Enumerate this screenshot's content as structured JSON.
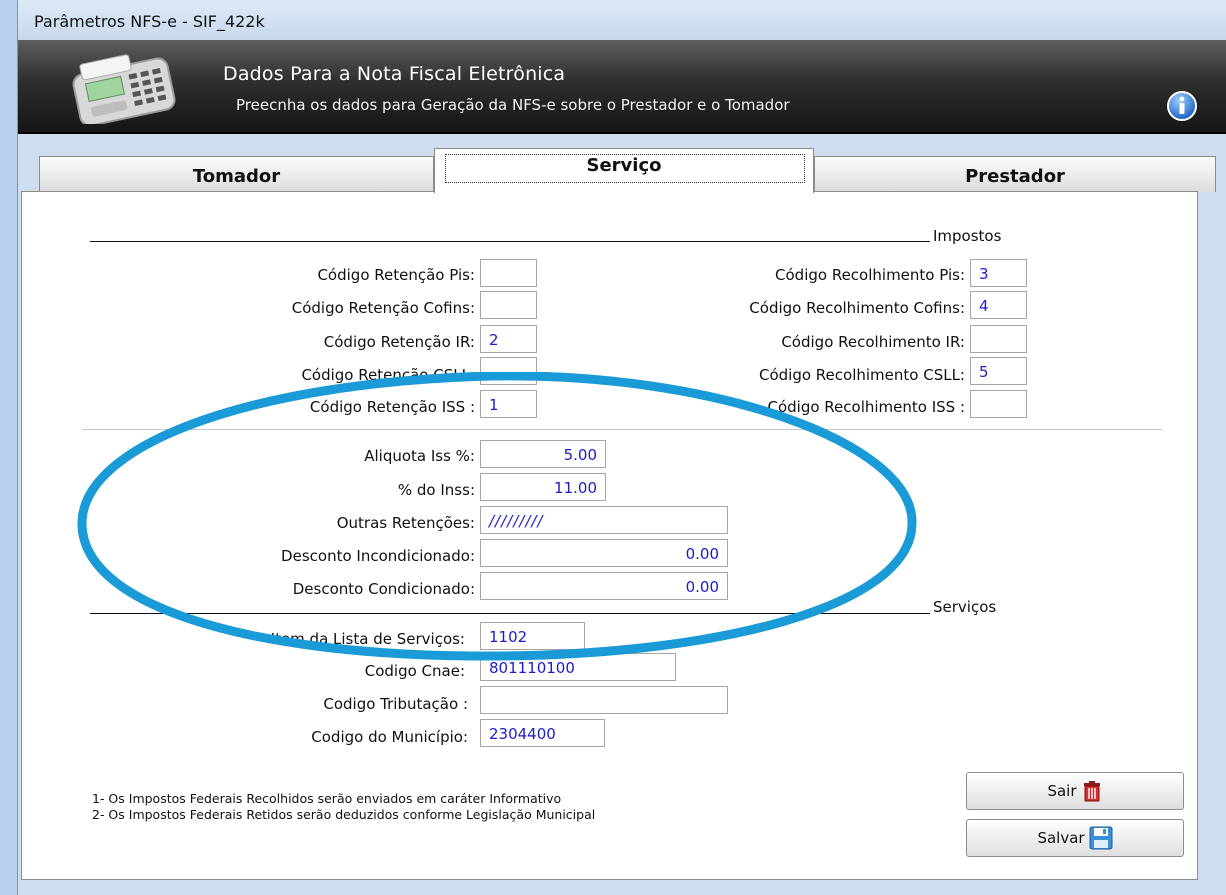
{
  "window": {
    "title": "Parâmetros NFS-e - SIF_422k"
  },
  "header": {
    "title": "Dados Para a Nota Fiscal Eletrônica",
    "subtitle": "Preecnha os dados para Geração da NFS-e sobre o Prestador e o Tomador",
    "left_icon": "card-terminal-icon",
    "right_icon": "info-icon"
  },
  "tabs": {
    "tomador": "Tomador",
    "servico": "Serviço",
    "prestador": "Prestador",
    "active": "Serviço"
  },
  "impostos": {
    "section_label": "Impostos",
    "retencao_pis": {
      "label": "Código Retenção Pis:",
      "value": ""
    },
    "retencao_cofins": {
      "label": "Código Retenção Cofins:",
      "value": ""
    },
    "retencao_ir": {
      "label": "Código Retenção IR:",
      "value": "2"
    },
    "retencao_csll": {
      "label": "Código Retenção CSLL:",
      "value": ""
    },
    "retencao_iss": {
      "label": "Código Retenção ISS :",
      "value": "1"
    },
    "recolhimento_pis": {
      "label": "Código Recolhimento Pis:",
      "value": "3"
    },
    "recolhimento_cofins": {
      "label": "Código Recolhimento Cofins:",
      "value": "4"
    },
    "recolhimento_ir": {
      "label": "Código Recolhimento IR:",
      "value": ""
    },
    "recolhimento_csll": {
      "label": "Código Recolhimento CSLL:",
      "value": "5"
    },
    "recolhimento_iss": {
      "label": "Código Recolhimento ISS :",
      "value": ""
    }
  },
  "valores": {
    "aliquota_iss": {
      "label": "Aliquota Iss %:",
      "value": "5.00"
    },
    "inss": {
      "label": "% do Inss:",
      "value": "11.00"
    },
    "outras_retencoes": {
      "label": "Outras Retenções:",
      "value": "/////////"
    },
    "desconto_incondicionado": {
      "label": "Desconto Incondicionado:",
      "value": "0.00"
    },
    "desconto_condicionado": {
      "label": "Desconto Condicionado:",
      "value": "0.00"
    }
  },
  "servicos": {
    "section_label": "Serviços",
    "item_lista": {
      "label": "Item da Lista de Serviços:",
      "value": "1102"
    },
    "codigo_cnae": {
      "label": "Codigo Cnae:",
      "value": "801110100"
    },
    "codigo_tributacao": {
      "label": "Codigo Tributação :",
      "value": ""
    },
    "codigo_municipio": {
      "label": "Codigo do Município:",
      "value": "2304400"
    }
  },
  "notes": [
    "1- Os Impostos Federais Recolhidos serão enviados em caráter Informativo",
    "2- Os Impostos Federais Retidos serão deduzidos conforme Legislação Municipal"
  ],
  "buttons": {
    "sair": {
      "label": "Sair",
      "icon": "trash-icon"
    },
    "salvar": {
      "label": "Salvar",
      "icon": "floppy-disk-icon"
    }
  },
  "annotation": {
    "color": "#1a9bd8"
  }
}
